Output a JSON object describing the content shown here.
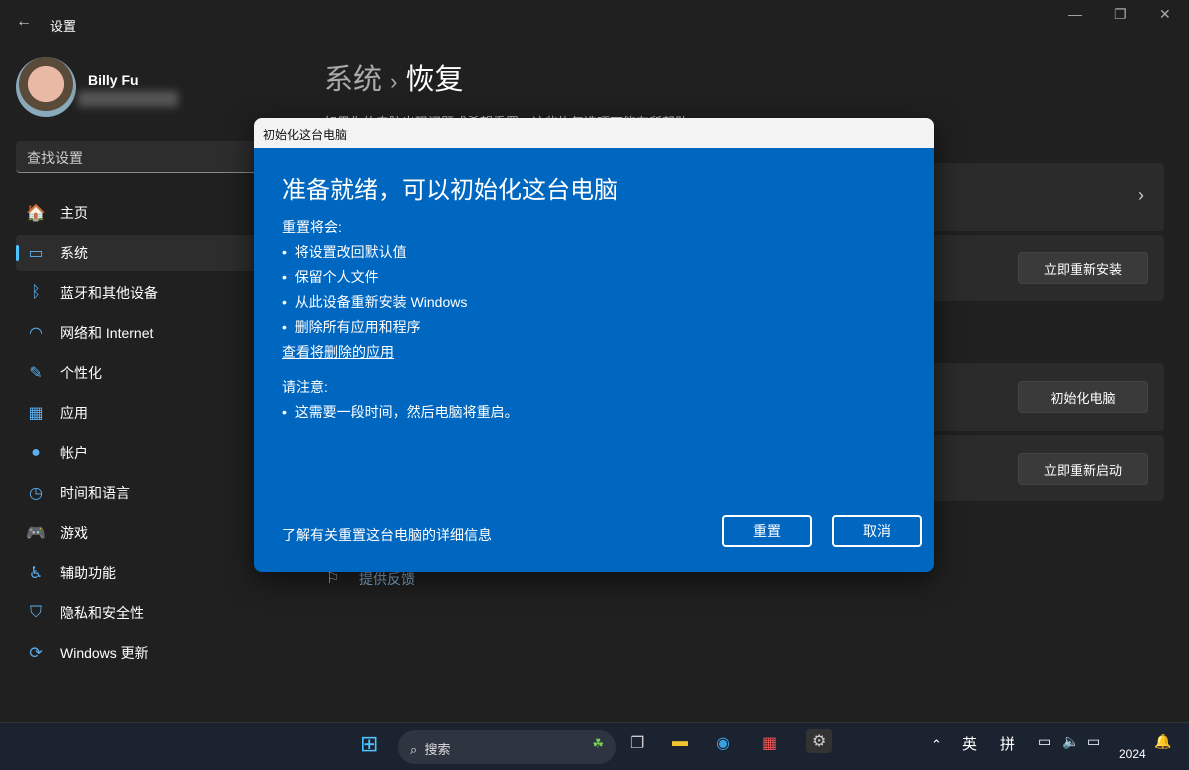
{
  "window": {
    "title": "设置",
    "back_icon": "arrow-left-icon"
  },
  "user": {
    "name": "Billy Fu"
  },
  "search": {
    "placeholder": "查找设置"
  },
  "sidebar": {
    "items": [
      {
        "label": "主页",
        "icon": "home-icon",
        "glyph": "🏠"
      },
      {
        "label": "系统",
        "icon": "monitor-icon",
        "glyph": "▭",
        "selected": true
      },
      {
        "label": "蓝牙和其他设备",
        "icon": "bluetooth-icon",
        "glyph": "ᛒ"
      },
      {
        "label": "网络和 Internet",
        "icon": "wifi-icon",
        "glyph": "◠"
      },
      {
        "label": "个性化",
        "icon": "brush-icon",
        "glyph": "✎"
      },
      {
        "label": "应用",
        "icon": "apps-icon",
        "glyph": "▦"
      },
      {
        "label": "帐户",
        "icon": "person-icon",
        "glyph": "●"
      },
      {
        "label": "时间和语言",
        "icon": "clock-globe-icon",
        "glyph": "◷"
      },
      {
        "label": "游戏",
        "icon": "gamepad-icon",
        "glyph": "🎮"
      },
      {
        "label": "辅助功能",
        "icon": "accessibility-icon",
        "glyph": "♿"
      },
      {
        "label": "隐私和安全性",
        "icon": "shield-icon",
        "glyph": "⛉"
      },
      {
        "label": "Windows 更新",
        "icon": "update-icon",
        "glyph": "⟳"
      }
    ]
  },
  "main": {
    "breadcrumb_parent": "系统",
    "breadcrumb_sep": "›",
    "title": "恢复",
    "subtitle": "如果你的电脑出现问题或希望重置，这些恢复选项可能有所帮助",
    "buttons": {
      "reinstall": "立即重新安装",
      "reset": "初始化电脑",
      "restart": "立即重新启动"
    },
    "feedback": "提供反馈"
  },
  "dialog": {
    "window_title": "初始化这台电脑",
    "heading": "准备就绪，可以初始化这台电脑",
    "will_label": "重置将会:",
    "will_items": [
      "将设置改回默认值",
      "保留个人文件",
      "从此设备重新安装 Windows",
      "删除所有应用和程序"
    ],
    "view_apps_link": "查看将删除的应用",
    "note_label": "请注意:",
    "note_items": [
      "这需要一段时间，然后电脑将重启。"
    ],
    "learn_more": "了解有关重置这台电脑的详细信息",
    "reset_button": "重置",
    "cancel_button": "取消"
  },
  "taskbar": {
    "search_placeholder": "搜索",
    "ime_lang": "英",
    "ime_mode": "拼",
    "clock": "2024"
  }
}
